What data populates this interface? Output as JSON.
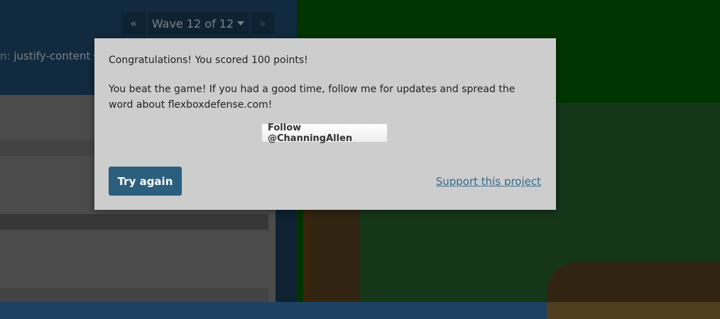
{
  "wave_nav": {
    "prev_icon": "«",
    "wave_label": "Wave 12 of 12",
    "next_icon": "»"
  },
  "property_line": {
    "prefix": "n:",
    "property": "justify-content"
  },
  "modal": {
    "score_message": "Congratulations! You scored 100 points!",
    "beat_message": "You beat the game! If you had a good time, follow me for updates and spread the word about flexboxdefense.com!",
    "follow_label": "Follow @ChanningAllen",
    "try_again_label": "Try again",
    "support_label": "Support this project"
  },
  "colors": {
    "board_green": "#005400",
    "path_brown": "#4f3d1e",
    "button_blue": "#2c5f7e"
  }
}
